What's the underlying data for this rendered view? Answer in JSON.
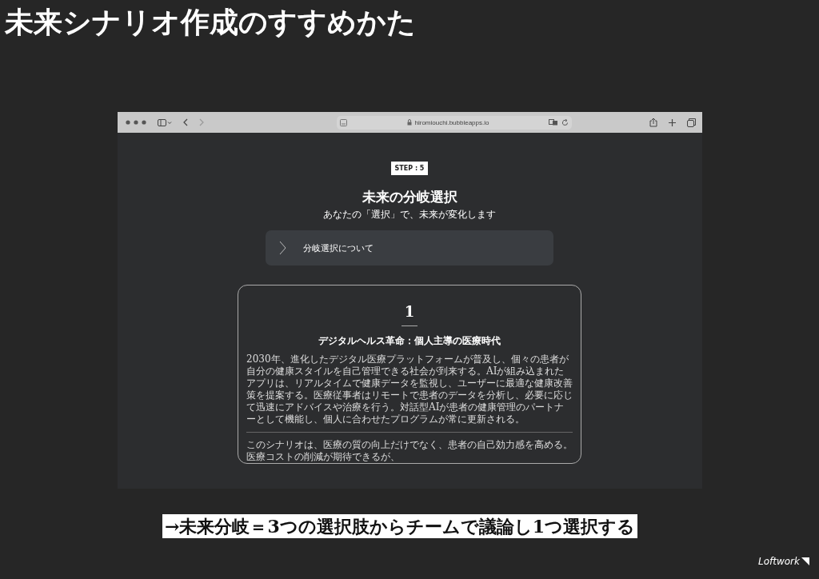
{
  "slide": {
    "title": "未来シナリオ作成のすすめかた",
    "caption": "→未来分岐＝3つの選択肢からチームで議論し1つ選択する",
    "logo": "Loftwork"
  },
  "browser": {
    "url": "hiromiouchi.bubbleapps.io"
  },
  "page": {
    "step_badge": "STEP : 5",
    "heading": "未来の分岐選択",
    "subheading": "あなたの「選択」で、未来が変化します",
    "accordion": {
      "label": "分岐選択について",
      "expanded": false
    },
    "cards": [
      {
        "number": "1",
        "title": "デジタルヘルス革命：個人主導の医療時代",
        "paragraphs": [
          "2030年、進化したデジタル医療プラットフォームが普及し、個々の患者が自分の健康スタイルを自己管理できる社会が到来する。AIが組み込まれたアプリは、リアルタイムで健康データを監視し、ユーザーに最適な健康改善策を提案する。医療従事者はリモートで患者のデータを分析し、必要に応じて迅速にアドバイスや治療を行う。対話型AIが患者の健康管理のパートナーとして機能し、個人に合わせたプログラムが常に更新される。",
          "このシナリオは、医療の質の向上だけでなく、患者の自己効力感を高める。医療コストの削減が期待できるが、"
        ]
      }
    ]
  }
}
